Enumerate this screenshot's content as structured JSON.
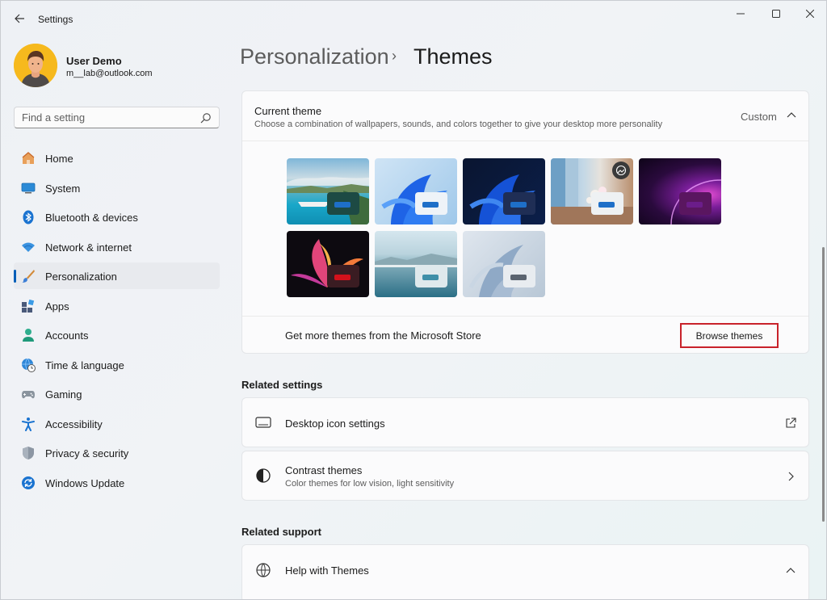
{
  "app": {
    "title": "Settings"
  },
  "user": {
    "name": "User Demo",
    "email": "m__lab@outlook.com"
  },
  "search": {
    "placeholder": "Find a setting"
  },
  "nav": {
    "items": [
      {
        "label": "Home",
        "icon": "home-icon"
      },
      {
        "label": "System",
        "icon": "system-icon"
      },
      {
        "label": "Bluetooth & devices",
        "icon": "bluetooth-icon"
      },
      {
        "label": "Network & internet",
        "icon": "wifi-icon"
      },
      {
        "label": "Personalization",
        "icon": "brush-icon",
        "active": true
      },
      {
        "label": "Apps",
        "icon": "apps-icon"
      },
      {
        "label": "Accounts",
        "icon": "account-icon"
      },
      {
        "label": "Time & language",
        "icon": "clock-globe-icon"
      },
      {
        "label": "Gaming",
        "icon": "gamepad-icon"
      },
      {
        "label": "Accessibility",
        "icon": "accessibility-icon"
      },
      {
        "label": "Privacy & security",
        "icon": "shield-icon"
      },
      {
        "label": "Windows Update",
        "icon": "update-icon"
      }
    ]
  },
  "breadcrumb": {
    "parent": "Personalization",
    "separator": "›",
    "current": "Themes"
  },
  "current_theme": {
    "title": "Current theme",
    "description": "Choose a combination of wallpapers, sounds, and colors together to give your desktop more personality",
    "value": "Custom",
    "themes": [
      {
        "name": "coastal-theme",
        "accent": "#1e6fc8"
      },
      {
        "name": "windows-light-theme",
        "accent": "#1e6fc8"
      },
      {
        "name": "windows-dark-theme",
        "accent": "#1e6fc8"
      },
      {
        "name": "spring-blossom-theme",
        "accent": "#1e6fc8"
      },
      {
        "name": "purple-glow-theme",
        "accent": "#6b1d8a"
      },
      {
        "name": "glow-flower-theme",
        "accent": "#d4111b"
      },
      {
        "name": "lake-theme",
        "accent": "#3f8fa8"
      },
      {
        "name": "captured-motion-theme",
        "accent": "#5b6470"
      }
    ]
  },
  "store": {
    "text": "Get more themes from the Microsoft Store",
    "button": "Browse themes"
  },
  "related_settings": {
    "heading": "Related settings",
    "items": [
      {
        "title": "Desktop icon settings",
        "subtitle": ""
      },
      {
        "title": "Contrast themes",
        "subtitle": "Color themes for low vision, light sensitivity"
      }
    ]
  },
  "related_support": {
    "heading": "Related support",
    "items": [
      {
        "title": "Help with Themes"
      }
    ]
  },
  "colors": {
    "accent": "#005fb8",
    "highlight_border": "#c8222a"
  }
}
